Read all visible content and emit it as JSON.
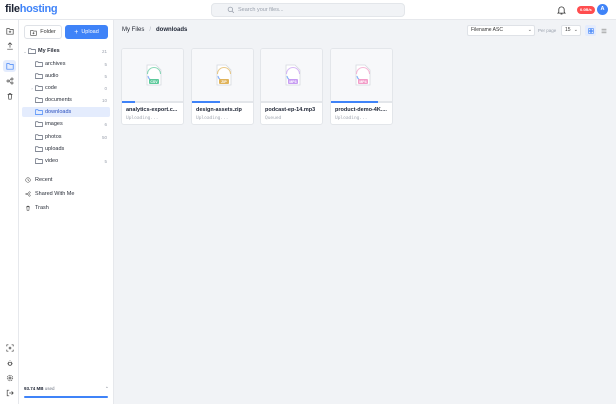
{
  "app": {
    "logo_main": "file",
    "logo_accent": "hosting"
  },
  "search": {
    "placeholder": "Search your files..."
  },
  "header": {
    "badge": "0.0B/s",
    "avatar_initial": "A"
  },
  "sidebar": {
    "folder_button": "Folder",
    "upload_button": "Upload",
    "tree": [
      {
        "label": "My Files",
        "count": "21",
        "level": 0,
        "expanded": true,
        "selected": false
      },
      {
        "label": "archives",
        "count": "5",
        "level": 1,
        "expanded": false,
        "selected": false
      },
      {
        "label": "audio",
        "count": "5",
        "level": 1,
        "expanded": false,
        "selected": false
      },
      {
        "label": "code",
        "count": "0",
        "level": 1,
        "expanded": false,
        "selected": false,
        "collapsible": true
      },
      {
        "label": "documents",
        "count": "10",
        "level": 1,
        "expanded": false,
        "selected": false
      },
      {
        "label": "downloads",
        "count": "",
        "level": 1,
        "expanded": false,
        "selected": true
      },
      {
        "label": "images",
        "count": "6",
        "level": 1,
        "expanded": false,
        "selected": false
      },
      {
        "label": "photos",
        "count": "50",
        "level": 1,
        "expanded": false,
        "selected": false
      },
      {
        "label": "uploads",
        "count": "",
        "level": 1,
        "expanded": false,
        "selected": false
      },
      {
        "label": "video",
        "count": "5",
        "level": 1,
        "expanded": false,
        "selected": false
      }
    ],
    "nav": [
      {
        "label": "Recent",
        "icon": "clock-icon"
      },
      {
        "label": "Shared With Me",
        "icon": "share-icon"
      },
      {
        "label": "Trash",
        "icon": "trash-icon"
      }
    ],
    "storage": {
      "used": "93.74 MB",
      "suffix": "used",
      "fraction": 1.0
    }
  },
  "toolbar": {
    "breadcrumb_root": "My Files",
    "breadcrumb_current": "downloads",
    "sort_value": "Filename ASC",
    "per_page_label": "Per page",
    "per_page_value": "15"
  },
  "files": [
    {
      "name": "analytics-export.c...",
      "status": "Uploading...",
      "ext": "CSV",
      "progress": 0.2,
      "color": "#5cc99b"
    },
    {
      "name": "design-assets.zip",
      "status": "Uploading...",
      "ext": "ZIP",
      "progress": 0.45,
      "color": "#e0b35a"
    },
    {
      "name": "podcast-ep-14.mp3",
      "status": "Queued",
      "ext": "MP3",
      "progress": 0.0,
      "color": "#c79cf2"
    },
    {
      "name": "product-demo-4K....",
      "status": "Uploading...",
      "ext": "MP4",
      "progress": 0.75,
      "color": "#f29cc8"
    }
  ],
  "colors": {
    "accent": "#3f83f8",
    "badge": "#ff4d4f",
    "selected_bg": "#e4ecfd"
  }
}
